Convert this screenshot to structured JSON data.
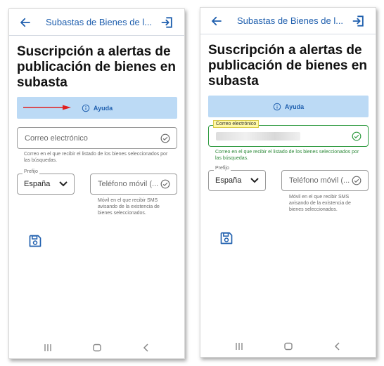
{
  "screens": [
    {
      "appbar": {
        "title": "Subastas de Bienes de l..."
      },
      "heading": "Suscripción a alertas de publicación de bienes en subasta",
      "help_button": {
        "label": "Ayuda"
      },
      "email": {
        "placeholder": "Correo electrónico",
        "helper": "Correo en el que recibir el listado de los bienes seleccionados por las búsquedas."
      },
      "prefix": {
        "label": "Prefijo",
        "value": "España"
      },
      "phone": {
        "placeholder": "Teléfono móvil (...",
        "helper": "Móvil en el que recibir SMS avisando de la existencia de bienes seleccionados."
      }
    },
    {
      "appbar": {
        "title": "Subastas de Bienes de l..."
      },
      "heading": "Suscripción a alertas de publicación de bienes en subasta",
      "help_button": {
        "label": "Ayuda"
      },
      "email": {
        "label": "Correo electrónico",
        "helper": "Correo en el que recibir el listado de los bienes seleccionados por las búsquedas."
      },
      "prefix": {
        "label": "Prefijo",
        "value": "España"
      },
      "phone": {
        "placeholder": "Teléfono móvil (...",
        "helper": "Móvil en el que recibir SMS avisando de la existencia de bienes seleccionados."
      }
    }
  ],
  "colors": {
    "primary": "#1f5fae",
    "help_bg": "#bcdaf5",
    "valid": "#2e9a3f",
    "annotation_arrow": "#e02020",
    "tooltip_bg": "#fff9a8"
  },
  "icons": [
    "back-arrow-icon",
    "exit-icon",
    "info-icon",
    "check-circle-icon",
    "chevron-down-icon",
    "save-icon",
    "recents-icon",
    "home-icon",
    "back-nav-icon"
  ]
}
